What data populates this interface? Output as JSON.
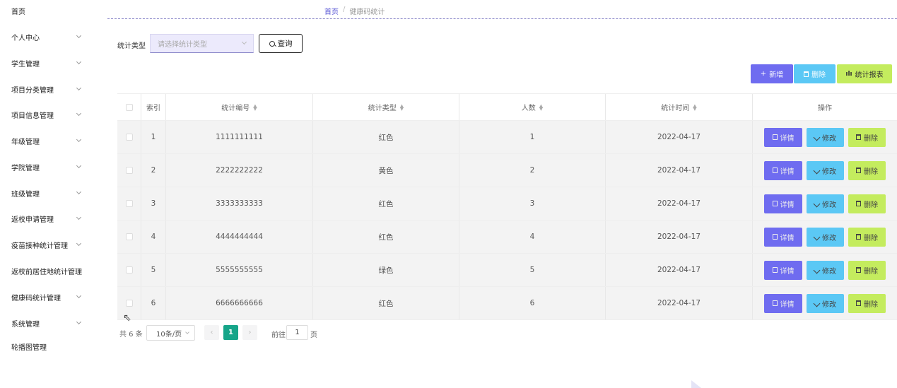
{
  "sidebar": {
    "items": [
      {
        "label": "首页",
        "has_children": false
      },
      {
        "label": "个人中心",
        "has_children": true
      },
      {
        "label": "学生管理",
        "has_children": true
      },
      {
        "label": "项目分类管理",
        "has_children": true
      },
      {
        "label": "项目信息管理",
        "has_children": true
      },
      {
        "label": "年级管理",
        "has_children": true
      },
      {
        "label": "学院管理",
        "has_children": true
      },
      {
        "label": "班级管理",
        "has_children": true
      },
      {
        "label": "返校申请管理",
        "has_children": true
      },
      {
        "label": "疫苗接种统计管理",
        "has_children": true
      },
      {
        "label": "返校前居住地统计管理",
        "has_children": false
      },
      {
        "label": "健康码统计管理",
        "has_children": true
      },
      {
        "label": "系统管理",
        "has_children": true
      },
      {
        "label": "轮播图管理",
        "has_children": false
      }
    ]
  },
  "breadcrumb": {
    "home": "首页",
    "separator": "/",
    "current": "健康码统计"
  },
  "filter": {
    "label": "统计类型",
    "placeholder": "请选择统计类型",
    "query_label": "查询"
  },
  "toolbar": {
    "add_label": "新增",
    "delete_label": "删除",
    "report_label": "统计报表"
  },
  "table": {
    "columns": [
      "索引",
      "统计编号",
      "统计类型",
      "人数",
      "统计时间",
      "操作"
    ],
    "rows": [
      {
        "index": "1",
        "code": "1111111111",
        "type": "红色",
        "count": "1",
        "time": "2022-04-17"
      },
      {
        "index": "2",
        "code": "2222222222",
        "type": "黄色",
        "count": "2",
        "time": "2022-04-17"
      },
      {
        "index": "3",
        "code": "3333333333",
        "type": "红色",
        "count": "3",
        "time": "2022-04-17"
      },
      {
        "index": "4",
        "code": "4444444444",
        "type": "红色",
        "count": "4",
        "time": "2022-04-17"
      },
      {
        "index": "5",
        "code": "5555555555",
        "type": "绿色",
        "count": "5",
        "time": "2022-04-17"
      },
      {
        "index": "6",
        "code": "6666666666",
        "type": "红色",
        "count": "6",
        "time": "2022-04-17"
      }
    ],
    "actions": {
      "detail": "详情",
      "edit": "修改",
      "delete": "删除"
    }
  },
  "pagination": {
    "total": "共 6 条",
    "page_size": "10条/页",
    "current_page": "1",
    "goto_prefix": "前往",
    "goto_value": "1",
    "goto_suffix": "页"
  },
  "colors": {
    "primary": "#6f6cf0",
    "info": "#5bc8f5",
    "lime": "#c4ec5e",
    "pager_active": "#16a589"
  }
}
